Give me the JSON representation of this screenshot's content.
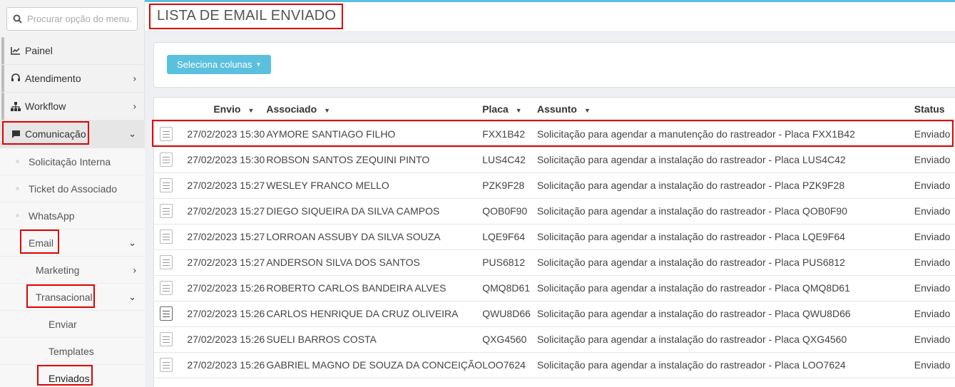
{
  "search": {
    "placeholder": "Procurar opção do menu..."
  },
  "sidebar": {
    "items": [
      {
        "label": "Painel"
      },
      {
        "label": "Atendimento"
      },
      {
        "label": "Workflow"
      },
      {
        "label": "Comunicação"
      }
    ],
    "comunicacao_sub": [
      {
        "label": "Solicitação Interna"
      },
      {
        "label": "Ticket do Associado"
      },
      {
        "label": "WhatsApp"
      },
      {
        "label": "Email"
      }
    ],
    "email_sub": [
      {
        "label": "Marketing"
      },
      {
        "label": "Transacional"
      }
    ],
    "transacional_sub": [
      {
        "label": "Enviar"
      },
      {
        "label": "Templates"
      },
      {
        "label": "Enviados"
      }
    ]
  },
  "page": {
    "title": "LISTA DE EMAIL ENVIADO"
  },
  "toolbar": {
    "columns_button": "Seleciona colunas"
  },
  "table": {
    "columns": [
      "Envio",
      "Associado",
      "Placa",
      "Assunto",
      "Status"
    ],
    "rows": [
      {
        "envio": "27/02/2023 15:30",
        "associado": "AYMORE SANTIAGO FILHO",
        "placa": "FXX1B42",
        "assunto": "Solicitação para agendar a manutenção do rastreador - Placa FXX1B42",
        "status": "Enviado"
      },
      {
        "envio": "27/02/2023 15:30",
        "associado": "ROBSON SANTOS ZEQUINI PINTO",
        "placa": "LUS4C42",
        "assunto": "Solicitação para agendar a instalação do rastreador - Placa LUS4C42",
        "status": "Enviado"
      },
      {
        "envio": "27/02/2023 15:27",
        "associado": "WESLEY FRANCO MELLO",
        "placa": "PZK9F28",
        "assunto": "Solicitação para agendar a instalação do rastreador - Placa PZK9F28",
        "status": "Enviado"
      },
      {
        "envio": "27/02/2023 15:27",
        "associado": "DIEGO SIQUEIRA DA SILVA CAMPOS",
        "placa": "QOB0F90",
        "assunto": "Solicitação para agendar a instalação do rastreador - Placa QOB0F90",
        "status": "Enviado"
      },
      {
        "envio": "27/02/2023 15:27",
        "associado": "LORROAN ASSUBY DA SILVA SOUZA",
        "placa": "LQE9F64",
        "assunto": "Solicitação para agendar a instalação do rastreador - Placa LQE9F64",
        "status": "Enviado"
      },
      {
        "envio": "27/02/2023 15:27",
        "associado": "ANDERSON SILVA DOS SANTOS",
        "placa": "PUS6812",
        "assunto": "Solicitação para agendar a instalação do rastreador - Placa PUS6812",
        "status": "Enviado"
      },
      {
        "envio": "27/02/2023 15:26",
        "associado": "ROBERTO CARLOS BANDEIRA ALVES",
        "placa": "QMQ8D61",
        "assunto": "Solicitação para agendar a instalação do rastreador - Placa QMQ8D61",
        "status": "Enviado"
      },
      {
        "envio": "27/02/2023 15:26",
        "associado": "CARLOS HENRIQUE DA CRUZ OLIVEIRA",
        "placa": "QWU8D66",
        "assunto": "Solicitação para agendar a instalação do rastreador - Placa QWU8D66",
        "status": "Enviado"
      },
      {
        "envio": "27/02/2023 15:26",
        "associado": "SUELI BARROS COSTA",
        "placa": "QXG4560",
        "assunto": "Solicitação para agendar a instalação do rastreador - Placa QXG4560",
        "status": "Enviado"
      },
      {
        "envio": "27/02/2023 15:26",
        "associado": "GABRIEL MAGNO DE SOUZA DA CONCEIÇÃO",
        "placa": "LOO7624",
        "assunto": "Solicitação para agendar a instalação do rastreador - Placa LOO7624",
        "status": "Enviado"
      }
    ]
  },
  "colors": {
    "accent": "#5bc0de",
    "highlight": "#e00000"
  }
}
